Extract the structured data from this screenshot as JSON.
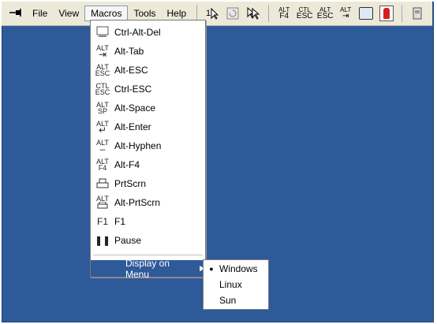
{
  "menubar": {
    "items": [
      {
        "label": "File"
      },
      {
        "label": "View"
      },
      {
        "label": "Macros"
      },
      {
        "label": "Tools"
      },
      {
        "label": "Help"
      }
    ],
    "toolbar_icons": [
      "single-cursor-icon",
      "refresh-icon",
      "dual-cursor-icon",
      "alt-f4-macro-icon",
      "ctl-esc-macro-icon",
      "alt-esc-macro-icon",
      "alt-tab-macro-icon",
      "video-settings-icon",
      "audio-icon",
      "smart-card-icon"
    ]
  },
  "macros_menu": {
    "items": [
      {
        "label": "Ctrl-Alt-Del",
        "icon": "monitor-icon"
      },
      {
        "label": "Alt-Tab",
        "icon": "alt-tab-icon"
      },
      {
        "label": "Alt-ESC",
        "icon": "alt-esc-icon"
      },
      {
        "label": "Ctrl-ESC",
        "icon": "ctl-esc-icon"
      },
      {
        "label": "Alt-Space",
        "icon": "alt-space-icon"
      },
      {
        "label": "Alt-Enter",
        "icon": "alt-enter-icon"
      },
      {
        "label": "Alt-Hyphen",
        "icon": "alt-hyphen-icon"
      },
      {
        "label": "Alt-F4",
        "icon": "alt-f4-icon"
      },
      {
        "label": "PrtScrn",
        "icon": "printer-icon"
      },
      {
        "label": "Alt-PrtScrn",
        "icon": "alt-printer-icon"
      },
      {
        "label": "F1",
        "icon": "f1-icon"
      },
      {
        "label": "Pause",
        "icon": "pause-icon"
      }
    ],
    "display_on_menu": "Display on Menu"
  },
  "submenu": {
    "items": [
      {
        "label": "Windows",
        "selected": true
      },
      {
        "label": "Linux",
        "selected": false
      },
      {
        "label": "Sun",
        "selected": false
      }
    ]
  },
  "icon_texts": {
    "alt": "ALT",
    "ctl": "CTL",
    "esc": "ESC",
    "f4": "F4",
    "sp": "SP",
    "f1": "F1"
  },
  "colors": {
    "workspace": "#2f5a9a",
    "highlight": "#2f5a9a",
    "menubar": "#ece9d8"
  }
}
